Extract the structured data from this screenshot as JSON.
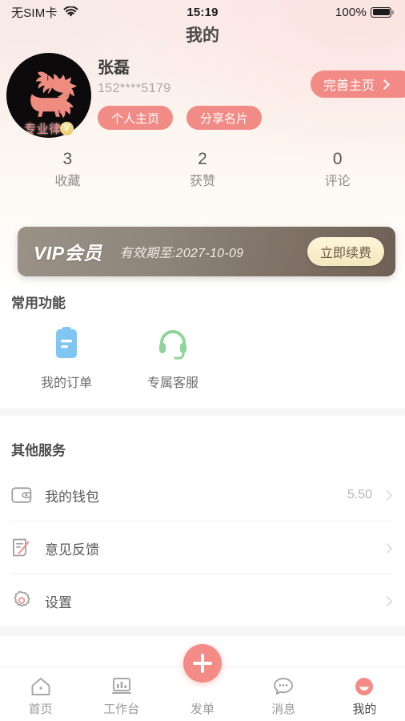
{
  "status_bar": {
    "carrier": "无SIM卡",
    "wifi_icon": "wifi-icon",
    "time": "15:19",
    "battery_percent": "100%",
    "battery_icon": "battery-full-icon"
  },
  "header": {
    "title": "我的"
  },
  "profile": {
    "avatar_icon": "lion-emblem-avatar",
    "verified_badge_text": "专业律",
    "verified_badge_mark": "V",
    "name": "张磊",
    "phone": "152****5179",
    "actions": [
      {
        "label": "个人主页",
        "name": "personal-homepage-button"
      },
      {
        "label": "分享名片",
        "name": "share-card-button"
      }
    ],
    "edit_home_label": "完善主页",
    "edit_home_chevron": "chevron-right-icon"
  },
  "stats": [
    {
      "value": "3",
      "label": "收藏"
    },
    {
      "value": "2",
      "label": "获赞"
    },
    {
      "value": "0",
      "label": "评论"
    }
  ],
  "vip": {
    "title": "VIP会员",
    "expiry": "有效期至:2027-10-09",
    "renew_label": "立即续费"
  },
  "common_functions": {
    "title": "常用功能",
    "items": [
      {
        "label": "我的订单",
        "icon": "clipboard-order-icon",
        "color": "#7FC7F2"
      },
      {
        "label": "专属客服",
        "icon": "headset-support-icon",
        "color": "#8FD59B"
      }
    ]
  },
  "other_services": {
    "title": "其他服务",
    "items": [
      {
        "label": "我的钱包",
        "icon": "wallet-icon",
        "value": "5.50"
      },
      {
        "label": "意见反馈",
        "icon": "feedback-edit-icon",
        "value": ""
      },
      {
        "label": "设置",
        "icon": "gear-icon",
        "value": ""
      }
    ]
  },
  "tabbar": {
    "items": [
      {
        "label": "首页",
        "icon": "home-icon",
        "active": false
      },
      {
        "label": "工作台",
        "icon": "workbench-chart-icon",
        "active": false
      },
      {
        "label": "发单",
        "icon": "plus-circle-icon",
        "active": false
      },
      {
        "label": "消息",
        "icon": "chat-bubble-icon",
        "active": false
      },
      {
        "label": "我的",
        "icon": "profile-smiley-icon",
        "active": true
      }
    ]
  },
  "colors": {
    "accent_pink": "#F08B86",
    "vip_dark": "#8E857B",
    "vip_button_cream": "#F6EFD6",
    "order_blue": "#7FC7F2",
    "support_green": "#8FD59B",
    "muted_text": "#9A9A9A"
  }
}
